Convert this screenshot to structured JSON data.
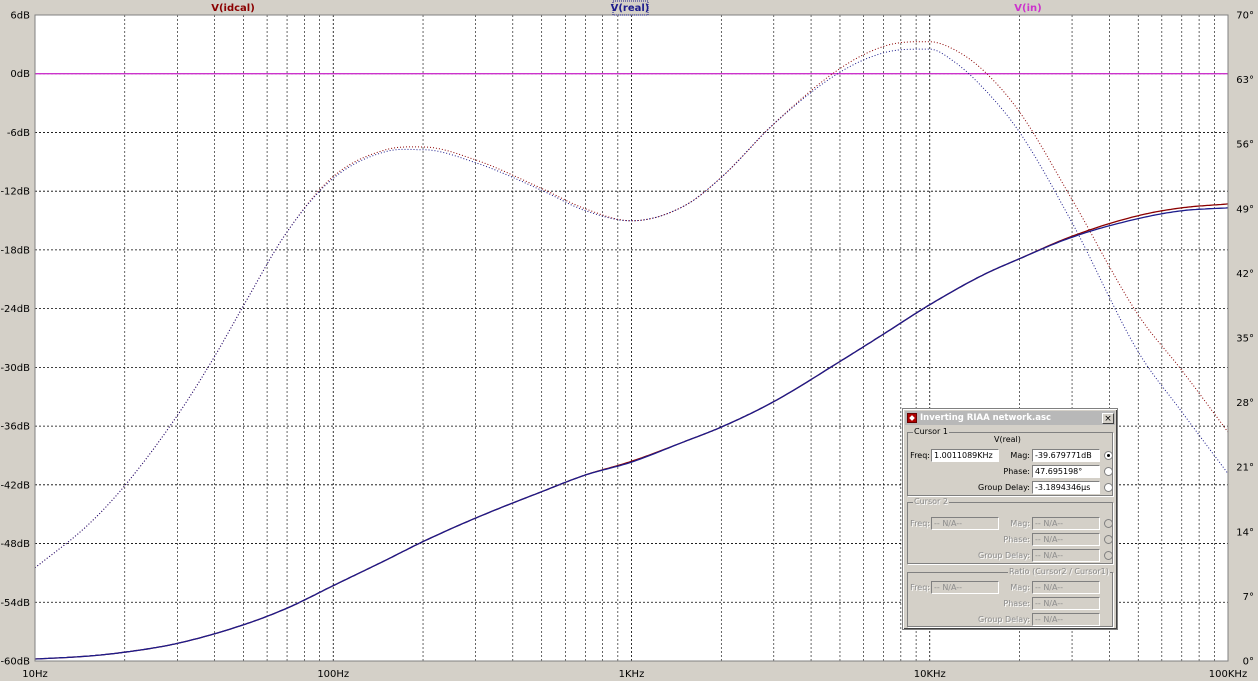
{
  "colors": {
    "plot_bg": "#ffffff",
    "grid": "#000000",
    "ideal": "#8b0000",
    "real": "#1c1c8c",
    "in": "#cc33cc"
  },
  "trace_labels": {
    "ideal": "V(idcal)",
    "real": "V(real)",
    "in": "V(in)"
  },
  "chart_data": {
    "type": "line",
    "x_scale": "log",
    "x_range": [
      10,
      100000
    ],
    "x_ticks": [
      {
        "value": 10,
        "label": "10Hz"
      },
      {
        "value": 100,
        "label": "100Hz"
      },
      {
        "value": 1000,
        "label": "1KHz"
      },
      {
        "value": 10000,
        "label": "10KHz"
      },
      {
        "value": 100000,
        "label": "100KHz"
      }
    ],
    "y_left": {
      "range": [
        -60,
        6
      ],
      "ticks": [
        {
          "value": 6,
          "label": "6dB"
        },
        {
          "value": 0,
          "label": "0dB"
        },
        {
          "value": -6,
          "label": "-6dB"
        },
        {
          "value": -12,
          "label": "-12dB"
        },
        {
          "value": -18,
          "label": "-18dB"
        },
        {
          "value": -24,
          "label": "-24dB"
        },
        {
          "value": -30,
          "label": "-30dB"
        },
        {
          "value": -36,
          "label": "-36dB"
        },
        {
          "value": -42,
          "label": "-42dB"
        },
        {
          "value": -48,
          "label": "-48dB"
        },
        {
          "value": -54,
          "label": "-54dB"
        },
        {
          "value": -60,
          "label": "-60dB"
        }
      ]
    },
    "y_right": {
      "range": [
        0,
        70
      ],
      "ticks": [
        {
          "value": 70,
          "label": "70°"
        },
        {
          "value": 63,
          "label": "63°"
        },
        {
          "value": 56,
          "label": "56°"
        },
        {
          "value": 49,
          "label": "49°"
        },
        {
          "value": 42,
          "label": "42°"
        },
        {
          "value": 35,
          "label": "35°"
        },
        {
          "value": 28,
          "label": "28°"
        },
        {
          "value": 21,
          "label": "21°"
        },
        {
          "value": 14,
          "label": "14°"
        },
        {
          "value": 7,
          "label": "7°"
        },
        {
          "value": 0,
          "label": "0°"
        }
      ]
    },
    "grid": true,
    "series": [
      {
        "name": "V(idcal)",
        "kind": "magnitude",
        "axis": "left",
        "style": "solid",
        "color": "#8b0000",
        "x": [
          10,
          15,
          20,
          30,
          50,
          70,
          100,
          150,
          200,
          300,
          500,
          700,
          1000,
          1500,
          2000,
          3000,
          5000,
          7000,
          10000,
          15000,
          20000,
          30000,
          50000,
          70000,
          100000
        ],
        "y": [
          -59.8,
          -59.5,
          -59.1,
          -58.2,
          -56.3,
          -54.6,
          -52.3,
          -49.7,
          -47.8,
          -45.4,
          -42.7,
          -41.0,
          -39.6,
          -37.6,
          -36.1,
          -33.5,
          -29.4,
          -26.6,
          -23.6,
          -20.6,
          -18.9,
          -16.6,
          -14.5,
          -13.7,
          -13.3
        ]
      },
      {
        "name": "V(real)",
        "kind": "magnitude",
        "axis": "left",
        "style": "solid",
        "color": "#1c1c8c",
        "x": [
          10,
          15,
          20,
          30,
          50,
          70,
          100,
          150,
          200,
          300,
          500,
          700,
          1000,
          1500,
          2000,
          3000,
          5000,
          7000,
          10000,
          15000,
          20000,
          30000,
          50000,
          70000,
          100000
        ],
        "y": [
          -59.8,
          -59.5,
          -59.1,
          -58.2,
          -56.3,
          -54.6,
          -52.3,
          -49.7,
          -47.8,
          -45.4,
          -42.7,
          -41.0,
          -39.68,
          -37.6,
          -36.1,
          -33.5,
          -29.4,
          -26.6,
          -23.6,
          -20.6,
          -18.9,
          -16.7,
          -14.8,
          -14.0,
          -13.7
        ]
      },
      {
        "name": "V(idcal)",
        "kind": "phase",
        "axis": "right",
        "style": "dotted",
        "color": "#8b0000",
        "x": [
          10,
          15,
          20,
          30,
          40,
          50,
          70,
          100,
          150,
          200,
          300,
          500,
          700,
          1000,
          1500,
          2000,
          3000,
          5000,
          7000,
          9000,
          10000,
          12000,
          15000,
          20000,
          30000,
          50000,
          70000,
          100000
        ],
        "y": [
          10.1,
          14.7,
          19.0,
          26.6,
          33.0,
          38.5,
          46.5,
          52.5,
          55.4,
          55.7,
          54.3,
          51.2,
          49.0,
          47.7,
          49.3,
          52.4,
          58.2,
          64.2,
          66.6,
          67.1,
          67.1,
          66.3,
          64.1,
          59.5,
          50.0,
          37.5,
          31.5,
          24.8
        ]
      },
      {
        "name": "V(real)",
        "kind": "phase",
        "axis": "right",
        "style": "dotted",
        "color": "#1c1c8c",
        "x": [
          10,
          15,
          20,
          30,
          40,
          50,
          70,
          100,
          150,
          200,
          300,
          500,
          700,
          1000,
          1500,
          2000,
          3000,
          5000,
          7000,
          9000,
          10000,
          12000,
          15000,
          20000,
          30000,
          50000,
          70000,
          100000
        ],
        "y": [
          10.1,
          14.7,
          19.0,
          26.6,
          33.0,
          38.5,
          46.5,
          52.3,
          55.2,
          55.4,
          54.0,
          51.0,
          48.8,
          47.7,
          49.3,
          52.4,
          58.2,
          63.8,
          65.9,
          66.3,
          66.3,
          65.0,
          62.2,
          57.3,
          47.5,
          33.5,
          27.0,
          20.3
        ]
      },
      {
        "name": "V(in)",
        "kind": "magnitude",
        "axis": "left",
        "style": "solid",
        "color": "#cc33cc",
        "x": [
          10,
          100000
        ],
        "y": [
          0,
          0
        ]
      },
      {
        "name": "V(in)",
        "kind": "phase",
        "axis": "right",
        "style": "dotted",
        "color": "#cc33cc",
        "x": [
          10,
          100000
        ],
        "y": [
          0,
          0
        ]
      }
    ]
  },
  "dialog": {
    "title": "Inverting RIAA network.asc",
    "close": "×",
    "cursor1": {
      "group": "Cursor 1",
      "trace": "V(real)",
      "freq_label": "Freq:",
      "freq": "1.0011089KHz",
      "mag_label": "Mag:",
      "mag": "-39.679771dB",
      "phase_label": "Phase:",
      "phase": "47.695198°",
      "gd_label": "Group Delay:",
      "gd": "-3.1894346µs"
    },
    "cursor2": {
      "group": "Cursor 2",
      "freq_label": "Freq:",
      "freq": "-- N/A--",
      "mag_label": "Mag:",
      "mag": "-- N/A--",
      "phase_label": "Phase:",
      "phase": "-- N/A--",
      "gd_label": "Group Delay:",
      "gd": "-- N/A--"
    },
    "ratio": {
      "group": "Ratio (Cursor2 / Cursor1)",
      "freq_label": "Freq:",
      "freq": "-- N/A--",
      "mag_label": "Mag:",
      "mag": "-- N/A--",
      "phase_label": "Phase:",
      "phase": "-- N/A--",
      "gd_label": "Group Delay:",
      "gd": "-- N/A--"
    }
  }
}
